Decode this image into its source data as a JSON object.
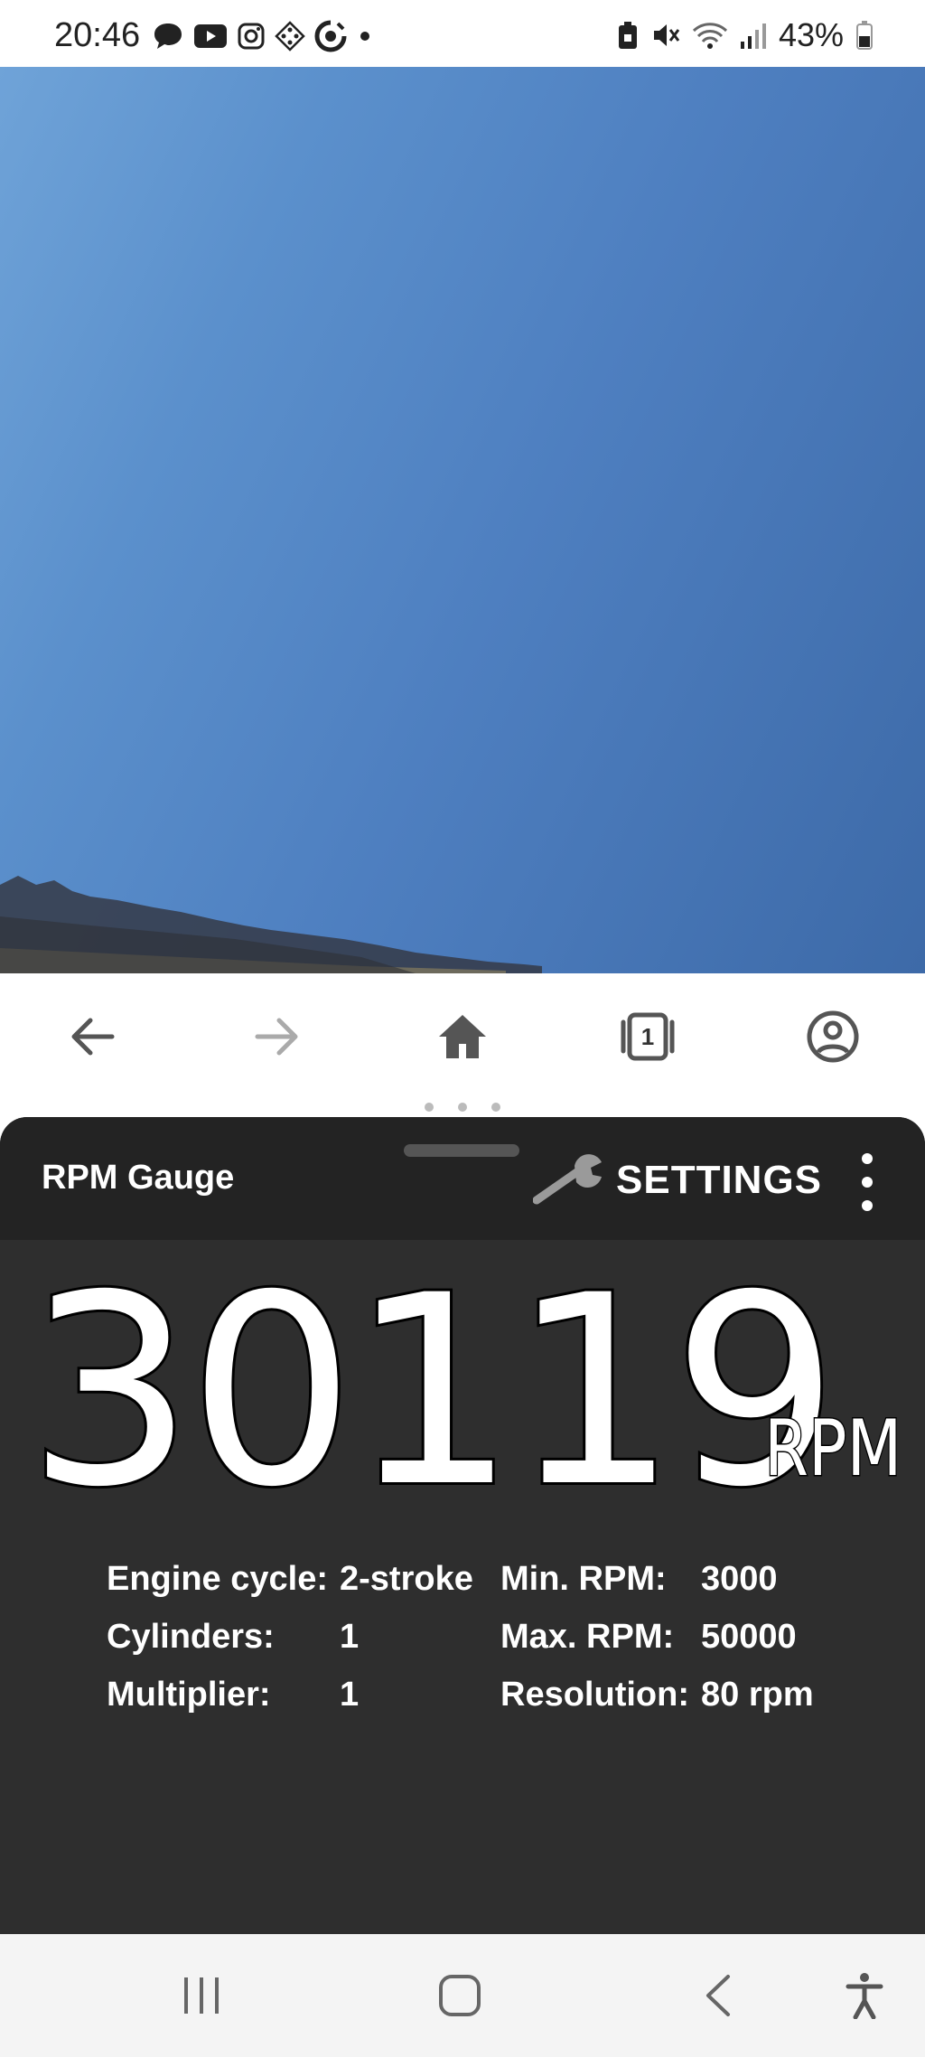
{
  "status_bar": {
    "time": "20:46",
    "battery": "43%",
    "left_icons": [
      "chat-bubble-icon",
      "youtube-icon",
      "instagram-icon",
      "game-controller-icon",
      "dial-icon",
      "dot-icon"
    ],
    "right_icons": [
      "lock-battery-icon",
      "mute-icon",
      "wifi-icon",
      "signal-icon",
      "battery-icon"
    ]
  },
  "browser_bar": {
    "tab_count": "1",
    "icons": [
      "back-arrow-icon",
      "forward-arrow-icon",
      "home-icon",
      "tabs-icon",
      "account-icon"
    ]
  },
  "app": {
    "title": "RPM Gauge",
    "settings_label": "SETTINGS",
    "rpm_value": "30119",
    "rpm_unit": "RPM",
    "stats": [
      {
        "label": "Engine cycle:",
        "value": "2-stroke",
        "label2": "Min. RPM:",
        "value2": "3000"
      },
      {
        "label": "Cylinders:",
        "value": "1",
        "label2": "Max. RPM:",
        "value2": "50000"
      },
      {
        "label": "Multiplier:",
        "value": "1",
        "label2": "Resolution:",
        "value2": "80 rpm"
      }
    ]
  },
  "colors": {
    "panel_bg": "#2e2e2e",
    "toolbar_bg": "#232323",
    "text": "#ffffff",
    "sky_light": "#6fa3d8",
    "sky_dark": "#3d6aa8"
  },
  "system_nav": {
    "icons": [
      "recent-apps-icon",
      "home-button-icon",
      "back-icon",
      "accessibility-icon"
    ]
  }
}
